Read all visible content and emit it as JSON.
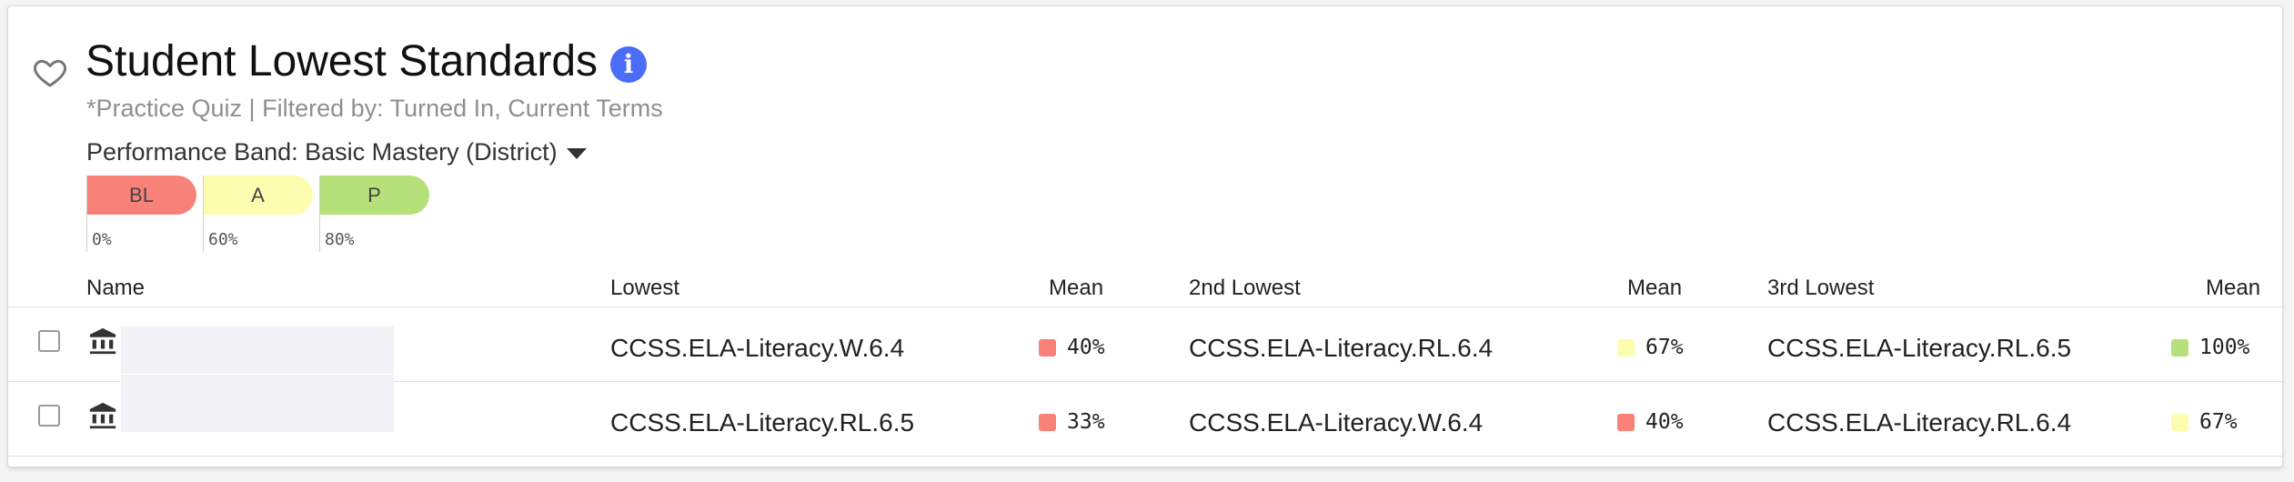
{
  "header": {
    "title": "Student Lowest Standards",
    "subtitle": "*Practice Quiz | Filtered by: Turned In, Current Terms",
    "performance_band_label": "Performance Band: Basic Mastery (District)"
  },
  "legend": [
    {
      "label": "BL",
      "threshold": "0%",
      "color": "#f8817a"
    },
    {
      "label": "A",
      "threshold": "60%",
      "color": "#fdfdb0"
    },
    {
      "label": "P",
      "threshold": "80%",
      "color": "#b5e07a"
    }
  ],
  "table": {
    "columns": {
      "name": "Name",
      "lowest": "Lowest",
      "mean1": "Mean",
      "second": "2nd Lowest",
      "mean2": "Mean",
      "third": "3rd Lowest",
      "mean3": "Mean"
    },
    "rows": [
      {
        "lowest": "CCSS.ELA-Literacy.W.6.4",
        "lowest_mean": "40%",
        "lowest_color": "#f8817a",
        "second": "CCSS.ELA-Literacy.RL.6.4",
        "second_mean": "67%",
        "second_color": "#fdfdb0",
        "third": "CCSS.ELA-Literacy.RL.6.5",
        "third_mean": "100%",
        "third_color": "#b5e07a"
      },
      {
        "lowest": "CCSS.ELA-Literacy.RL.6.5",
        "lowest_mean": "33%",
        "lowest_color": "#f8817a",
        "second": "CCSS.ELA-Literacy.W.6.4",
        "second_mean": "40%",
        "second_color": "#f8817a",
        "third": "CCSS.ELA-Literacy.RL.6.4",
        "third_mean": "67%",
        "third_color": "#fdfdb0"
      }
    ]
  },
  "icons": {
    "favorite": "heart-outline-icon",
    "info": "info-icon",
    "dropdown": "caret-down-icon",
    "student": "institution-icon"
  },
  "accent_color": "#4a6cf7"
}
